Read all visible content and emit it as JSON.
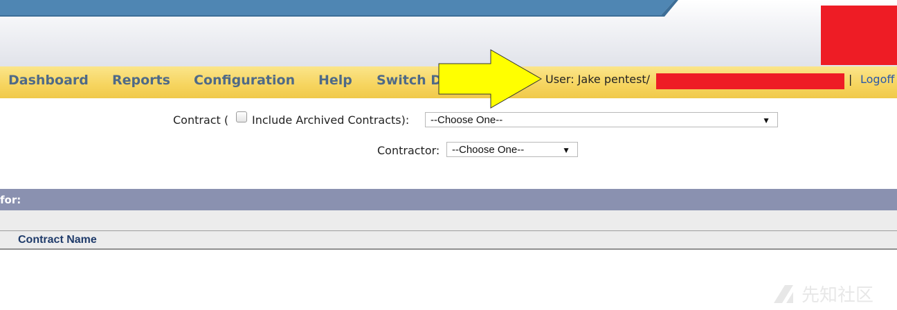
{
  "nav": {
    "items": [
      "Dashboard",
      "Reports",
      "Configuration",
      "Help",
      "Switch D"
    ]
  },
  "user": {
    "label": "User: Jake pentest/",
    "separator": "|",
    "logoff": "Logoff"
  },
  "form": {
    "contract_label_prefix": "Contract (",
    "include_archived_label": "Include Archived Contracts):",
    "include_archived_checked": false,
    "contract_select_value": "--Choose One--",
    "contractor_label": "Contractor:",
    "contractor_select_value": "--Choose One--"
  },
  "results": {
    "section_title": "for:",
    "column_header": "Contract Name"
  },
  "watermark": "先知社区",
  "colors": {
    "nav_background": "#f6d45e",
    "nav_text": "#4f6a87",
    "section_bar": "#8a91b0",
    "redaction": "#ee1c25",
    "annotation_arrow": "#ffff00"
  }
}
